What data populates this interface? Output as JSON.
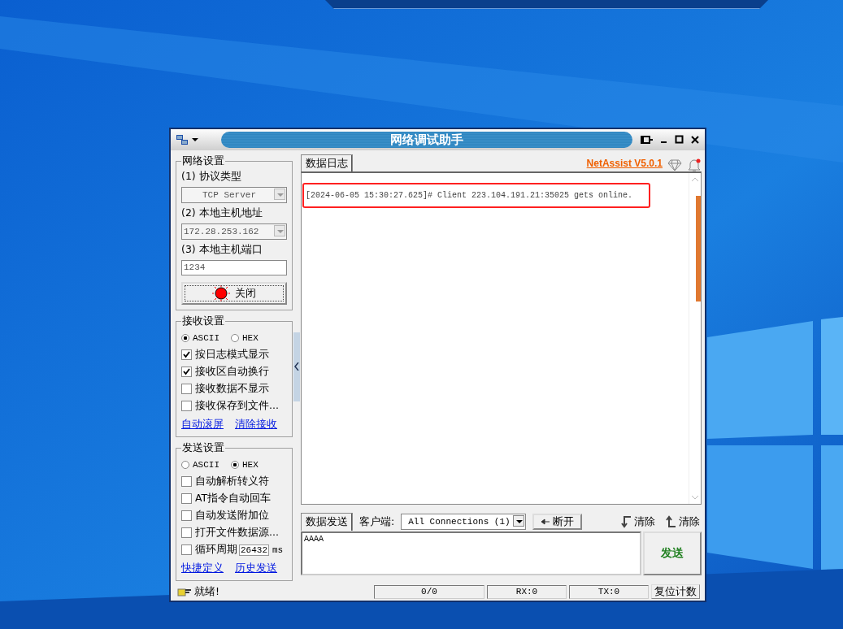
{
  "window": {
    "title": "网络调试助手"
  },
  "network_settings": {
    "title": "网络设置",
    "protocol_label": "(1) 协议类型",
    "protocol": "TCP Server",
    "host_label": "(2) 本地主机地址",
    "host": "172.28.253.162",
    "port_label": "(3) 本地主机端口",
    "port": "1234",
    "connect_button": "关闭",
    "connected": true
  },
  "receive_settings": {
    "title": "接收设置",
    "formats": [
      {
        "label": "ASCII",
        "selected": true
      },
      {
        "label": "HEX",
        "selected": false
      }
    ],
    "options": [
      {
        "kind": "check",
        "label": "按日志模式显示",
        "checked": true
      },
      {
        "kind": "check",
        "label": "接收区自动换行",
        "checked": true
      },
      {
        "kind": "check",
        "label": "接收数据不显示",
        "checked": false
      },
      {
        "kind": "check",
        "label": "接收保存到文件...",
        "checked": false
      }
    ],
    "links": [
      "自动滚屏",
      "清除接收"
    ]
  },
  "send_settings": {
    "title": "发送设置",
    "formats": [
      {
        "label": "ASCII",
        "selected": false
      },
      {
        "label": "HEX",
        "selected": true
      }
    ],
    "options": [
      {
        "kind": "check",
        "label": "自动解析转义符",
        "checked": false
      },
      {
        "kind": "check",
        "label": "AT指令自动回车",
        "checked": false
      },
      {
        "kind": "check",
        "label": "自动发送附加位",
        "checked": false
      },
      {
        "kind": "check",
        "label": "打开文件数据源...",
        "checked": false
      },
      {
        "kind": "period",
        "label": "循环周期",
        "checked": false,
        "value": "26432",
        "unit": "ms"
      }
    ],
    "links": [
      "快捷定义",
      "历史发送"
    ]
  },
  "log": {
    "tab": "数据日志",
    "version": "NetAssist V5.0.1",
    "highlighted": true,
    "lines": [
      "[2024-06-05 15:30:27.625]# Client 223.104.191.21:35025 gets online."
    ]
  },
  "send": {
    "tab": "数据发送",
    "client_label": "客户端:",
    "client": "All Connections (1)",
    "disconnect_button": "断开",
    "clear_buttons": [
      "清除",
      "清除"
    ],
    "value": "AAAA",
    "send_button": "发送"
  },
  "status_bar": {
    "message": "就绪!",
    "counter": "0/0",
    "rx": "RX:0",
    "tx": "TX:0",
    "reset_button": "复位计数"
  }
}
